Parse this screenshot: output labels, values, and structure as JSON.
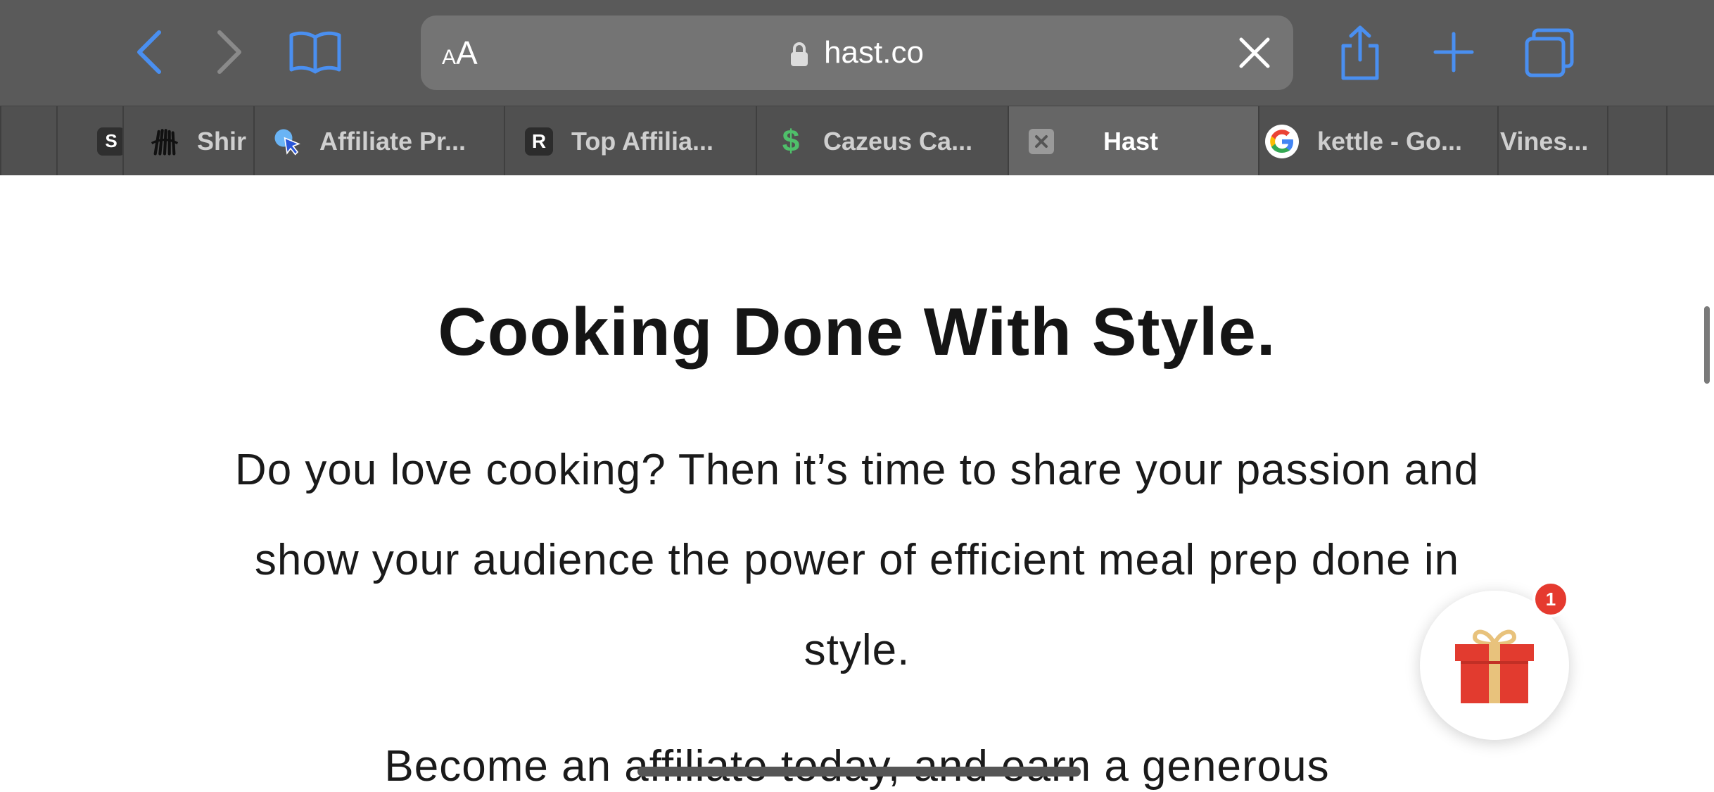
{
  "toolbar": {
    "reader_small": "A",
    "reader_big": "A",
    "url": "hast.co"
  },
  "tabs": [
    {
      "title": "S",
      "favicon": "square-s-icon"
    },
    {
      "title": "Shir",
      "favicon": "hands-logo-icon"
    },
    {
      "title": "Affiliate Pr...",
      "favicon": "cursor-click-icon"
    },
    {
      "title": "Top Affilia...",
      "favicon": "R",
      "favicon_glyph": "R"
    },
    {
      "title": "Cazeus Ca...",
      "favicon": "dollar-icon",
      "favicon_glyph": "$"
    },
    {
      "title": "Hast",
      "favicon": "close-square-icon",
      "active": true
    },
    {
      "title": "kettle - Go...",
      "favicon": "google-icon"
    },
    {
      "title": "Vines...",
      "favicon": ""
    }
  ],
  "page": {
    "heading": "Cooking Done With Style.",
    "paragraph": "Do you love cooking? Then it’s time to share your passion and show your audience the power of efficient meal prep done in style.",
    "paragraph2": "Become an affiliate today, and earn a generous"
  },
  "gift_widget": {
    "badge_count": "1"
  },
  "colors": {
    "accent": "#4a8ff0",
    "toolbar_bg": "#5a5a5a",
    "tabbar_bg": "#505050",
    "badge": "#e53a2f",
    "gift_red": "#e23b2f",
    "gift_ribbon": "#e8c27c"
  }
}
